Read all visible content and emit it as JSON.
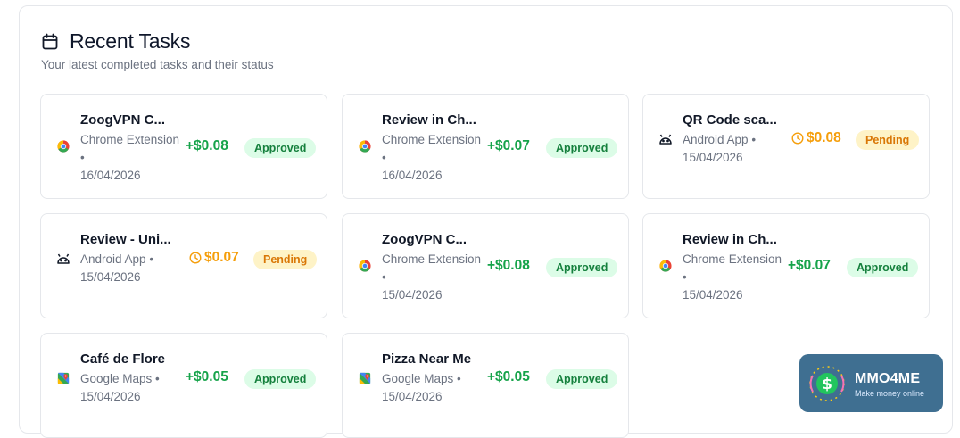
{
  "header": {
    "title": "Recent Tasks",
    "subtitle": "Your latest completed tasks and their status"
  },
  "tasks": [
    {
      "name": "ZoogVPN C...",
      "platform": "Chrome Extension",
      "date": "16/04/2026",
      "amount": "+$0.08",
      "status": "Approved",
      "icon": "chrome-icon"
    },
    {
      "name": "Review in Ch...",
      "platform": "Chrome Extension",
      "date": "16/04/2026",
      "amount": "+$0.07",
      "status": "Approved",
      "icon": "chrome-icon"
    },
    {
      "name": "QR Code sca...",
      "platform": "Android App",
      "date": "15/04/2026",
      "amount": "$0.08",
      "status": "Pending",
      "icon": "android-icon"
    },
    {
      "name": "Review - Uni...",
      "platform": "Android App",
      "date": "15/04/2026",
      "amount": "$0.07",
      "status": "Pending",
      "icon": "android-icon"
    },
    {
      "name": "ZoogVPN C...",
      "platform": "Chrome Extension",
      "date": "15/04/2026",
      "amount": "+$0.08",
      "status": "Approved",
      "icon": "chrome-icon"
    },
    {
      "name": "Review in Ch...",
      "platform": "Chrome Extension",
      "date": "15/04/2026",
      "amount": "+$0.07",
      "status": "Approved",
      "icon": "chrome-icon"
    },
    {
      "name": "Café de Flore",
      "platform": "Google Maps",
      "date": "15/04/2026",
      "amount": "+$0.05",
      "status": "Approved",
      "icon": "google-maps-icon"
    },
    {
      "name": "Pizza Near Me",
      "platform": "Google Maps",
      "date": "15/04/2026",
      "amount": "+$0.05",
      "status": "Approved",
      "icon": "google-maps-icon"
    }
  ],
  "logo": {
    "brand": "MMO4ME",
    "tagline": "Make money online"
  },
  "colors": {
    "approved_text": "#16a34a",
    "approved_badge_bg": "#dcfce7",
    "pending_text": "#f59e0b",
    "pending_badge_bg": "#fef3c7",
    "logo_bg": "#3f6f91"
  }
}
